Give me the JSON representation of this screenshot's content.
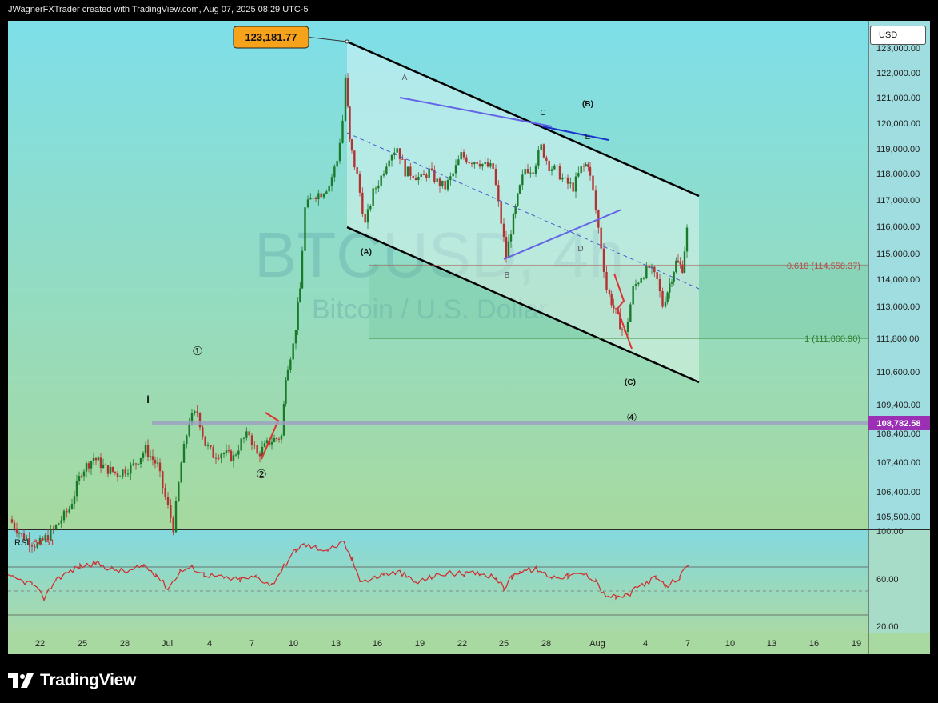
{
  "header": {
    "attribution": "JWagnerFXTrader created with TradingView.com, Aug 07, 2025 08:29 UTC-5"
  },
  "currency_button": "USD",
  "footer": {
    "brand": "TradingView"
  },
  "colors": {
    "bg_top": "#7edfe9",
    "bg_bottom": "#a7d99f",
    "candle_up": "#1a7a2a",
    "candle_down": "#b53030",
    "rsi_line": "#d12a2a",
    "channel": "#000000",
    "trend_blue": "#6464e6",
    "fib_0618": "#b84b4b",
    "fib_1": "#3a8a3a",
    "price_badge": "#f7a21b",
    "current_price_badge": "#9b30b5"
  },
  "chart_data": {
    "type": "candlestick",
    "symbol_watermark": "BTCUSD, 4h",
    "description_watermark": "Bitcoin / U.S. Dollar",
    "y_axis": {
      "ticks": [
        "123,000.00",
        "122,000.00",
        "121,000.00",
        "120,000.00",
        "119,000.00",
        "118,000.00",
        "117,000.00",
        "116,000.00",
        "115,000.00",
        "114,000.00",
        "113,000.00",
        "111,800.00",
        "110,600.00",
        "109,400.00",
        "108,400.00",
        "107,400.00",
        "106,400.00",
        "105,500.00"
      ],
      "ylim": [
        105000,
        123500
      ]
    },
    "x_axis": {
      "ticks": [
        "22",
        "25",
        "28",
        "Jul",
        "4",
        "7",
        "10",
        "13",
        "16",
        "19",
        "22",
        "25",
        "28",
        "Aug",
        "4",
        "7",
        "10",
        "13",
        "16",
        "19"
      ]
    },
    "price_high_label": "123,181.77",
    "current_price_label": "108,782.58",
    "fib_levels": [
      {
        "label": "0.618 (114,558.37)",
        "value": 114558.37
      },
      {
        "label": "1 (111,860.90)",
        "value": 111860.9
      }
    ],
    "wave_labels": {
      "channel_start": "(A)",
      "channel_top_a": "A",
      "b_small": "B",
      "c_small": "C",
      "d_small": "D",
      "e_small": "E",
      "b_big": "(B)",
      "c_big": "(C)",
      "i": "i",
      "one": "①",
      "two": "②",
      "four": "④"
    },
    "rsi": {
      "label": "RSI",
      "value": "64.51",
      "ticks": [
        "100.00",
        "60.00",
        "20.00"
      ],
      "upper": 70,
      "lower": 30
    }
  }
}
